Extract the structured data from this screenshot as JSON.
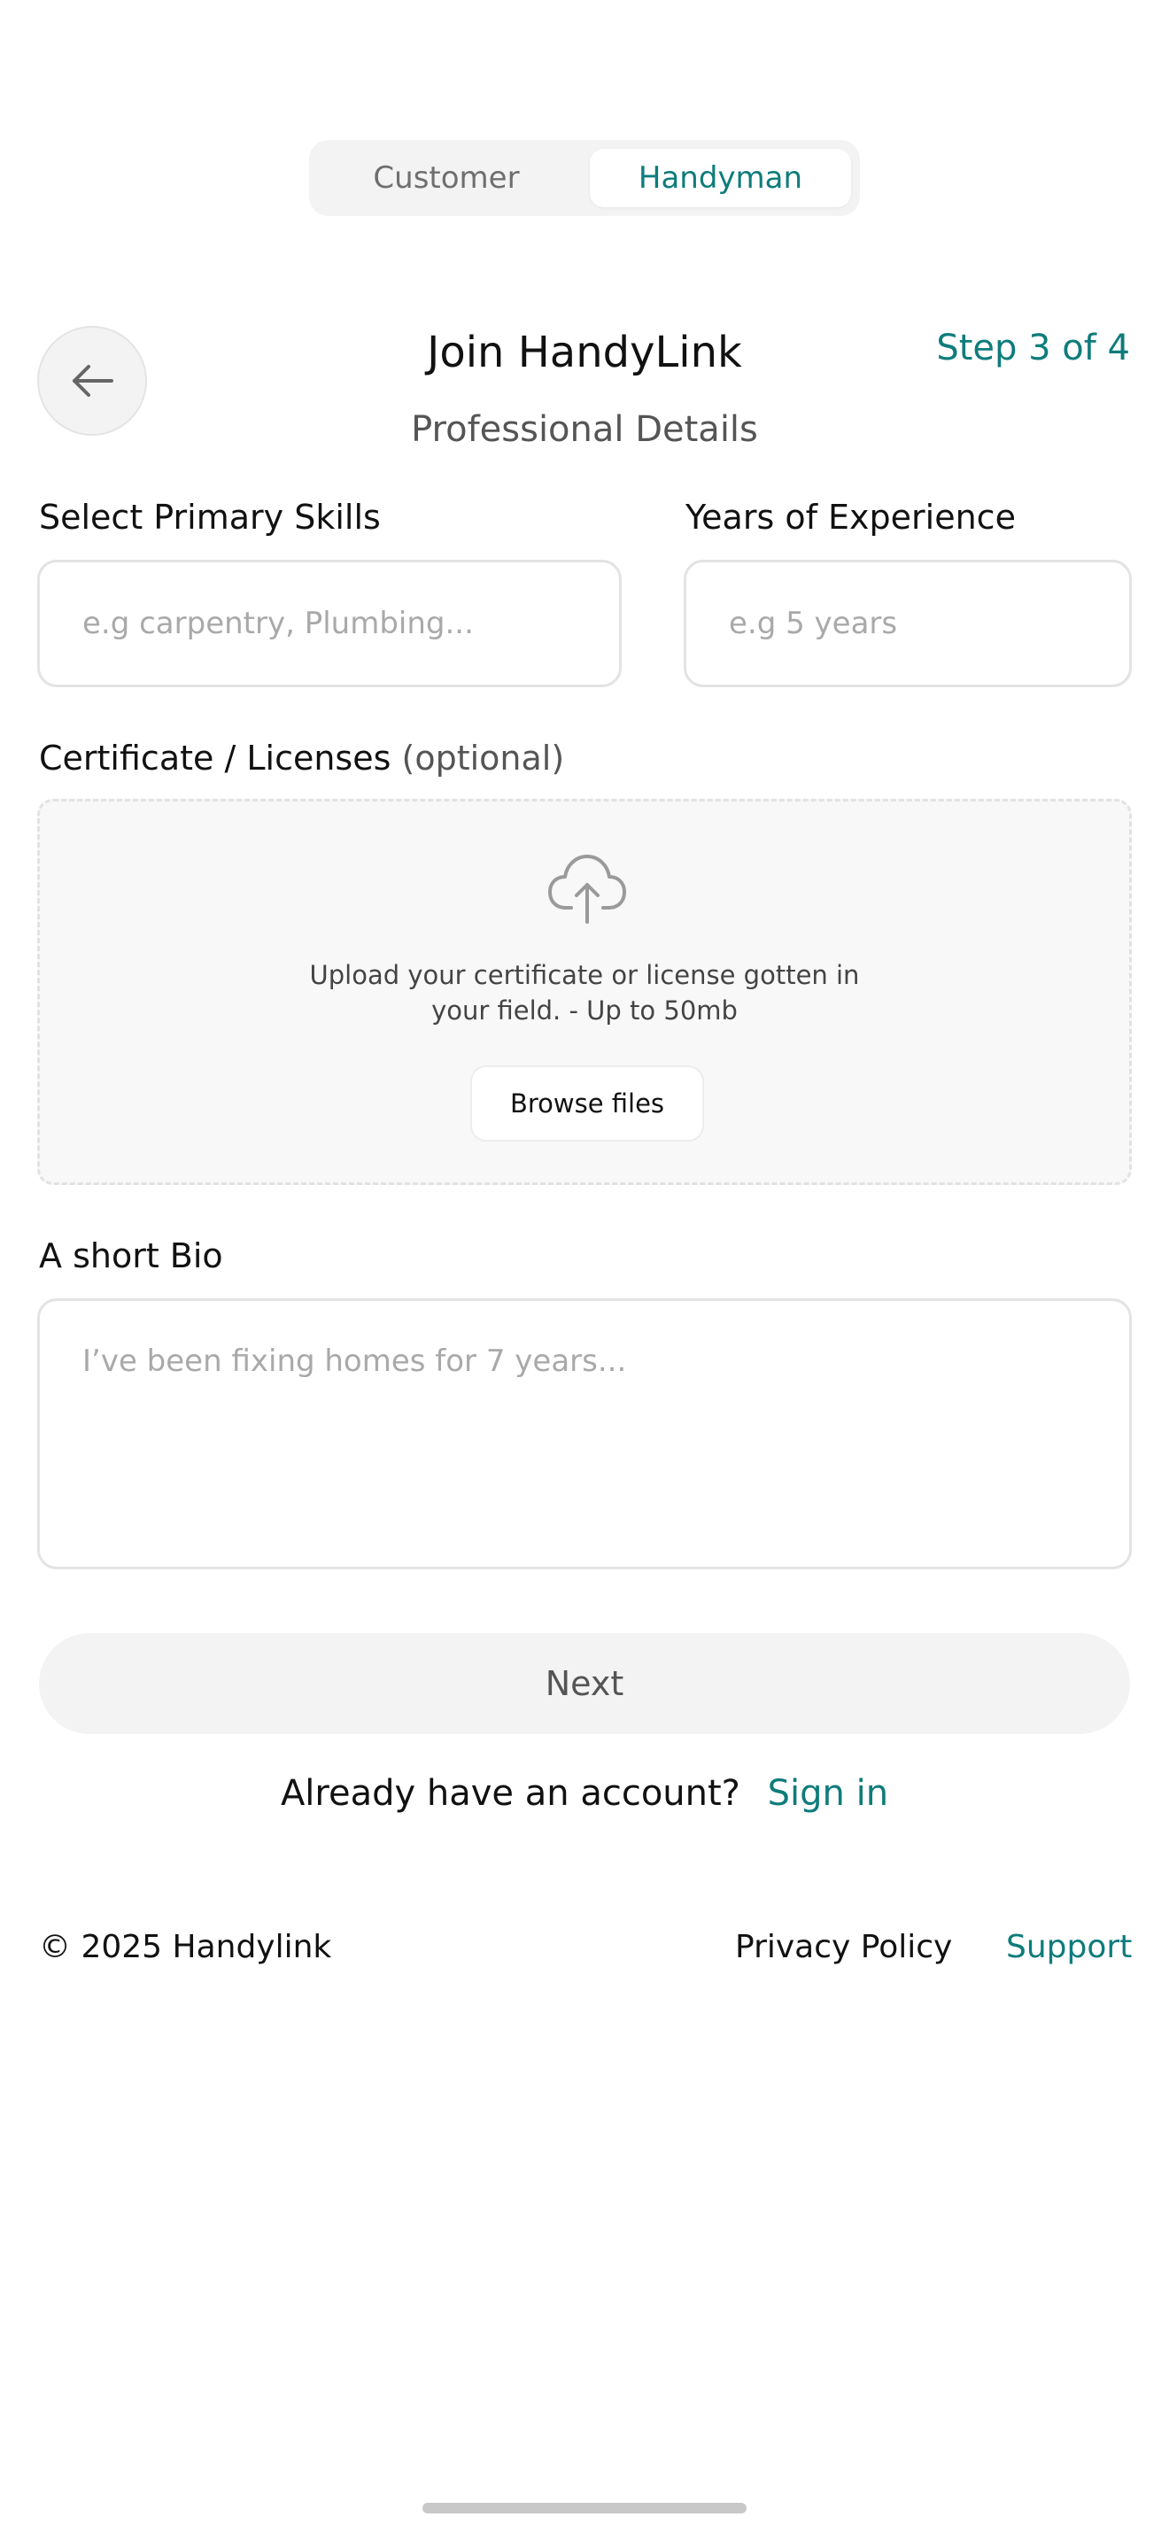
{
  "role_toggle": {
    "options": [
      "Customer",
      "Handyman"
    ],
    "selected": "Handyman"
  },
  "header": {
    "back_icon": "arrow-left-icon",
    "title": "Join HandyLink",
    "subtitle": "Professional Details",
    "step": "Step 3 of 4"
  },
  "form": {
    "skills_label": "Select Primary Skills",
    "skills_placeholder": "e.g carpentry, Plumbing...",
    "years_label": "Years of Experience",
    "years_placeholder": "e.g 5 years",
    "certificate_label": "Certificate / Licenses",
    "certificate_optional": "(optional)",
    "upload_icon": "cloud-upload-icon",
    "upload_text": "Upload your certificate or license gotten in your field. - Up to 50mb",
    "browse_label": "Browse files",
    "bio_label": "A short Bio",
    "bio_placeholder": "I’ve been fixing homes for 7 years..."
  },
  "actions": {
    "next_label": "Next",
    "signin_prompt": "Already have an account?",
    "signin_link": "Sign in"
  },
  "footer": {
    "copyright": "©  2025 Handylink",
    "privacy": "Privacy Policy",
    "support": "Support"
  },
  "colors": {
    "accent": "#0e7c7b",
    "muted_bg": "#f3f3f3",
    "border": "#e3e3e3"
  }
}
